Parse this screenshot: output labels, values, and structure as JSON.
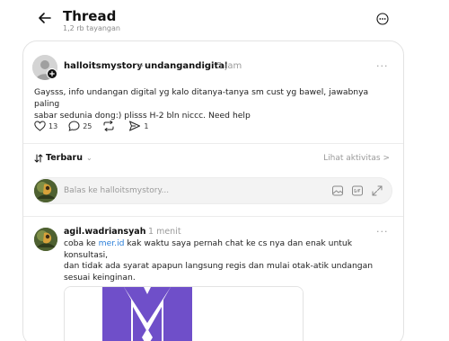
{
  "header": {
    "title": "Thread",
    "views": "1,2 rb tayangan"
  },
  "post": {
    "author": "halloitsmystory",
    "context_separator": ">",
    "context": "undangandigital",
    "time": "5 jam",
    "text_line1": "Gaysss, info undangan digital yg kalo ditanya-tanya sm cust yg bawel, jawabnya paling",
    "text_line2": "sabar sedunia dong:) plisss H-2 bln niccc. Need help",
    "likes": "13",
    "replies": "25",
    "shares": "1",
    "more": "···"
  },
  "sort": {
    "label": "Terbaru",
    "caret": "⌄",
    "activity": "Lihat aktivitas >"
  },
  "reply": {
    "placeholder": "Balas ke halloitsmystory..."
  },
  "comment": {
    "author": "agil.wadriansyah",
    "time": "1 menit",
    "more": "···",
    "text_pre": "coba ke ",
    "link": "mer.id",
    "text_post": " kak waktu saya pernah chat ke cs nya dan enak untuk konsultasi,",
    "text_line2": "dan tidak ada syarat apapun langsung regis dan mulai otak-atik undangan",
    "text_line3": "sesuai keinginan."
  },
  "colors": {
    "accent_link": "#2b7fd9",
    "media_brand": "#6f4fc9"
  },
  "icons": {
    "back": "arrow-left-icon",
    "more": "ellipsis-circle-icon",
    "like": "heart-icon",
    "reply": "comment-icon",
    "repost": "repost-icon",
    "share": "send-icon",
    "gallery": "image-icon",
    "gif": "gif-icon",
    "expand": "expand-icon"
  }
}
